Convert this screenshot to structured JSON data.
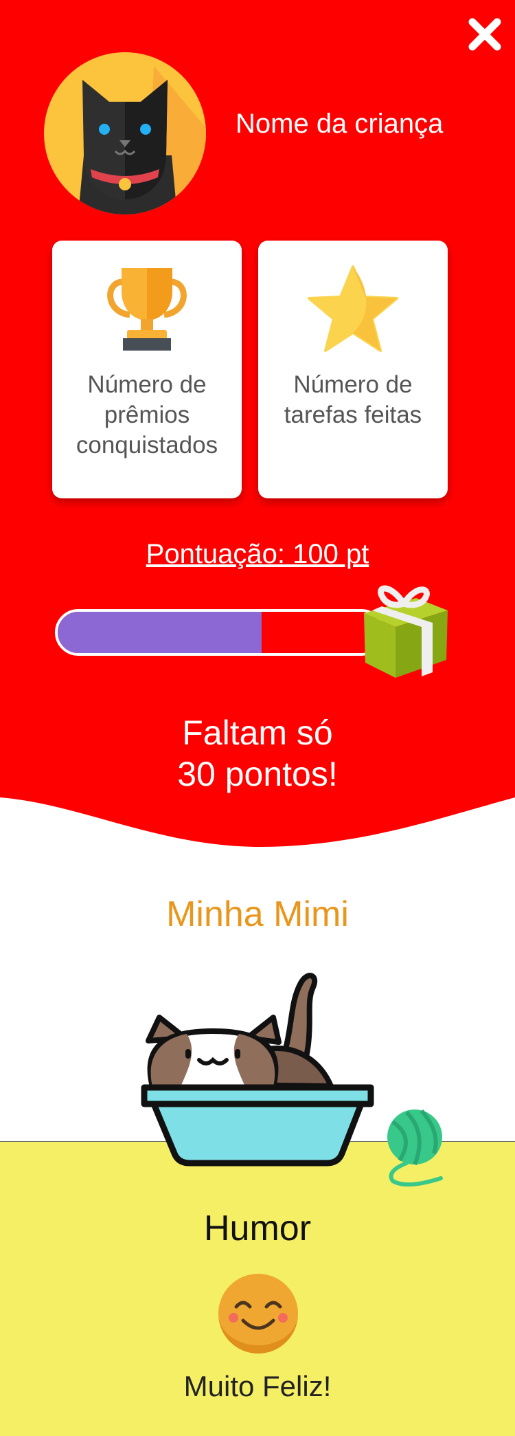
{
  "header": {
    "close_label": "close",
    "child_name": "Nome da criança"
  },
  "stats": {
    "cards": [
      {
        "label": "Número de prêmios conquistados",
        "icon": "trophy-icon"
      },
      {
        "label": "Número de tarefas feitas",
        "icon": "star-icon"
      }
    ]
  },
  "progress": {
    "score_text": "Pontuação: 100 pt",
    "fill_fraction": 0.63,
    "remaining_line1": "Faltam só",
    "remaining_line2": "30 pontos!"
  },
  "pet": {
    "title": "Minha Mimi"
  },
  "mood": {
    "title": "Humor",
    "value": "Muito Feliz!"
  },
  "colors": {
    "primary_red": "#ff0000",
    "progress_fill": "#8b68d3",
    "pet_title": "#e8961c",
    "mood_bg": "#f5ef66"
  }
}
